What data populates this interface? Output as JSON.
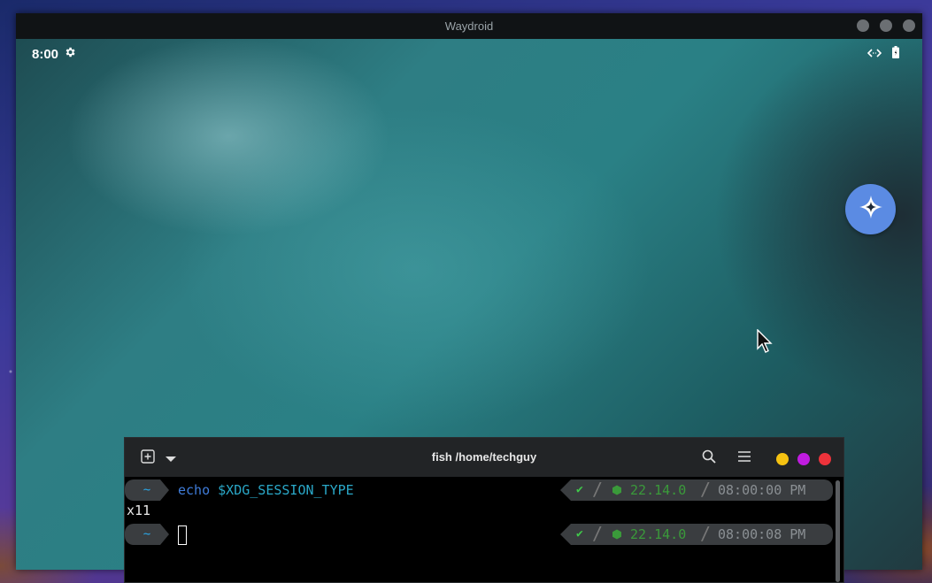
{
  "waydroid": {
    "title": "Waydroid",
    "clock": "8:00"
  },
  "terminal": {
    "title": "fish /home/techguy",
    "lines": [
      {
        "dir": "~",
        "cmd_keyword": "echo",
        "cmd_arg": "$XDG_SESSION_TYPE",
        "status_icon": "✔",
        "node_version": "22.14.0",
        "time": "08:00:00 PM"
      },
      {
        "dir": "~",
        "cmd_keyword": "",
        "cmd_arg": "",
        "status_icon": "✔",
        "node_version": "22.14.0",
        "time": "08:00:08 PM"
      }
    ],
    "output": "x11",
    "window_buttons": [
      "minimize",
      "maximize",
      "close"
    ],
    "colors": {
      "minimize": "#f5c211",
      "maximize": "#c01ce0",
      "close": "#ed333b"
    }
  },
  "icons": {
    "settings": "gear-icon",
    "fab": "sparkle-icon",
    "link": "code-arrows-icon",
    "battery": "battery-icon",
    "new_tab": "new-tab-icon",
    "dropdown": "chevron-down-icon",
    "search": "search-icon",
    "menu": "hamburger-icon"
  }
}
